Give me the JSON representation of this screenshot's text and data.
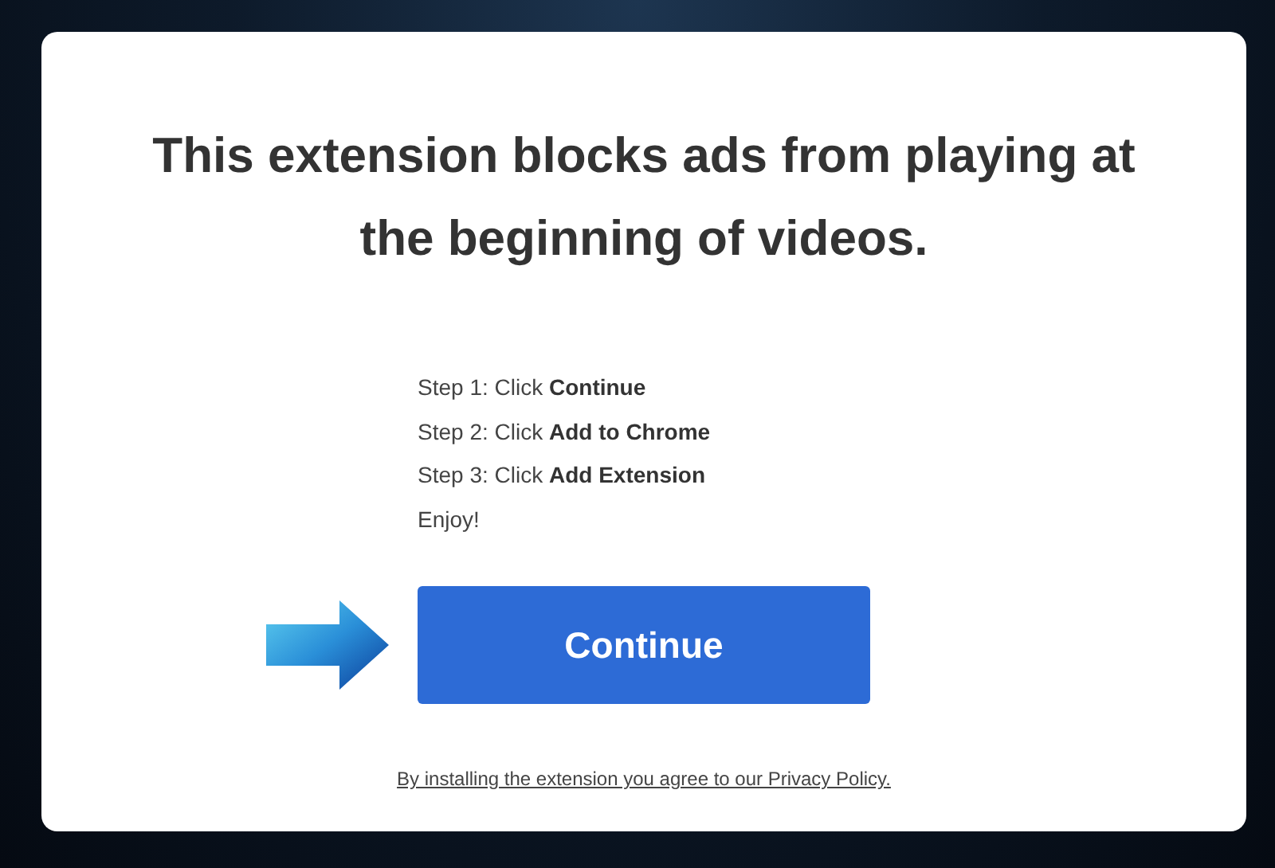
{
  "heading": "This extension blocks ads from playing at the beginning of videos.",
  "steps": [
    "Step 1: Click **Continue**",
    "Step 2: Click **Add to Chrome**",
    "Step 3: Click **Add Extension**",
    "Enjoy!"
  ],
  "button": {
    "label": "Continue"
  },
  "footer_link": "By installing the extension you agree to our Privacy Policy."
}
